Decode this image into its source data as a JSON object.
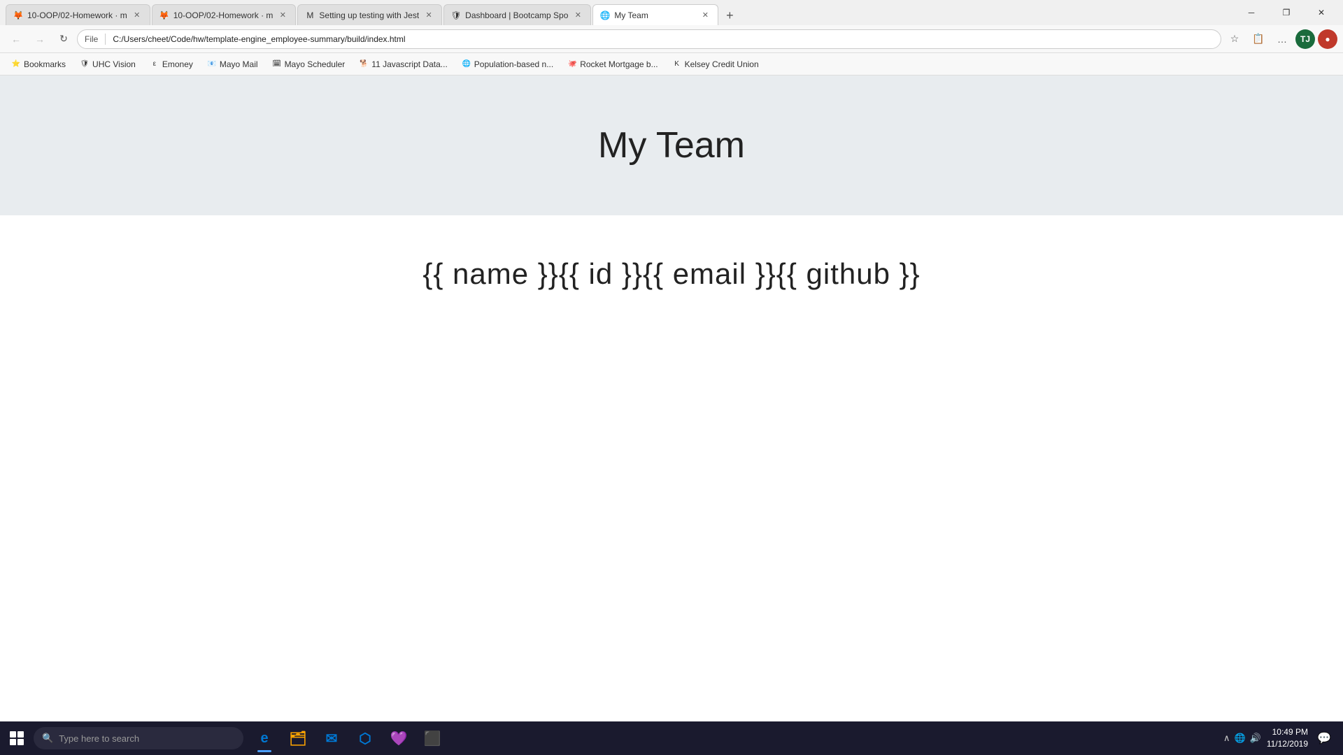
{
  "titlebar": {
    "tabs": [
      {
        "id": "tab1",
        "favicon": "🦊",
        "title": "10-OOP/02-Homework · m",
        "active": false,
        "favicon_color": "#e66000"
      },
      {
        "id": "tab2",
        "favicon": "🦊",
        "title": "10-OOP/02-Homework · m",
        "active": false,
        "favicon_color": "#e66000"
      },
      {
        "id": "tab3",
        "favicon": "M",
        "title": "Setting up testing with Jest",
        "active": false,
        "favicon_color": "#1a1a2e"
      },
      {
        "id": "tab4",
        "favicon": "🛡",
        "title": "Dashboard | Bootcamp Spo",
        "active": false,
        "favicon_color": "#8b1a1a"
      },
      {
        "id": "tab5",
        "favicon": "🌐",
        "title": "My Team",
        "active": true,
        "favicon_color": "#4a9eff"
      }
    ],
    "new_tab_label": "+",
    "minimize": "─",
    "restore": "❐",
    "close": "✕"
  },
  "navbar": {
    "back_title": "Back",
    "forward_title": "Forward",
    "refresh_title": "Refresh",
    "address_scheme": "File",
    "address_path": "C:/Users/cheet/Code/hw/template-engine_employee-summary/build/index.html",
    "profile_initials": "TJ"
  },
  "bookmarks": [
    {
      "id": "bm1",
      "favicon": "⭐",
      "label": "Bookmarks"
    },
    {
      "id": "bm2",
      "favicon": "🛡",
      "label": "UHC Vision"
    },
    {
      "id": "bm3",
      "favicon": "ε",
      "label": "Emoney"
    },
    {
      "id": "bm4",
      "favicon": "📧",
      "label": "Mayo Mail"
    },
    {
      "id": "bm5",
      "favicon": "🗓",
      "label": "Mayo Scheduler"
    },
    {
      "id": "bm6",
      "favicon": "🐕",
      "label": "11 Javascript Data..."
    },
    {
      "id": "bm7",
      "favicon": "🌐",
      "label": "Population-based n..."
    },
    {
      "id": "bm8",
      "favicon": "🐙",
      "label": "Rocket Mortgage b..."
    },
    {
      "id": "bm9",
      "favicon": "K",
      "label": "Kelsey Credit Union"
    }
  ],
  "page": {
    "title": "My Team",
    "template_text": "{{ name }}{{ id }}{{ email }}{{ github }}"
  },
  "taskbar": {
    "search_placeholder": "Type here to search",
    "apps": [
      {
        "id": "cortana",
        "icon": "○",
        "active": false
      },
      {
        "id": "edge",
        "icon": "e",
        "active": true,
        "color": "#0078d4"
      },
      {
        "id": "explorer",
        "icon": "🗂",
        "active": false
      },
      {
        "id": "mail",
        "icon": "✉",
        "active": false
      },
      {
        "id": "edge2",
        "icon": "e",
        "active": false
      },
      {
        "id": "vscode",
        "icon": "⬡",
        "active": false,
        "color": "#0078d4"
      },
      {
        "id": "slack",
        "icon": "S",
        "active": false,
        "color": "#4a154b"
      },
      {
        "id": "terminal",
        "icon": "▶",
        "active": false
      }
    ],
    "tray": {
      "time": "10:49 PM",
      "date": "11/12/2019"
    }
  }
}
